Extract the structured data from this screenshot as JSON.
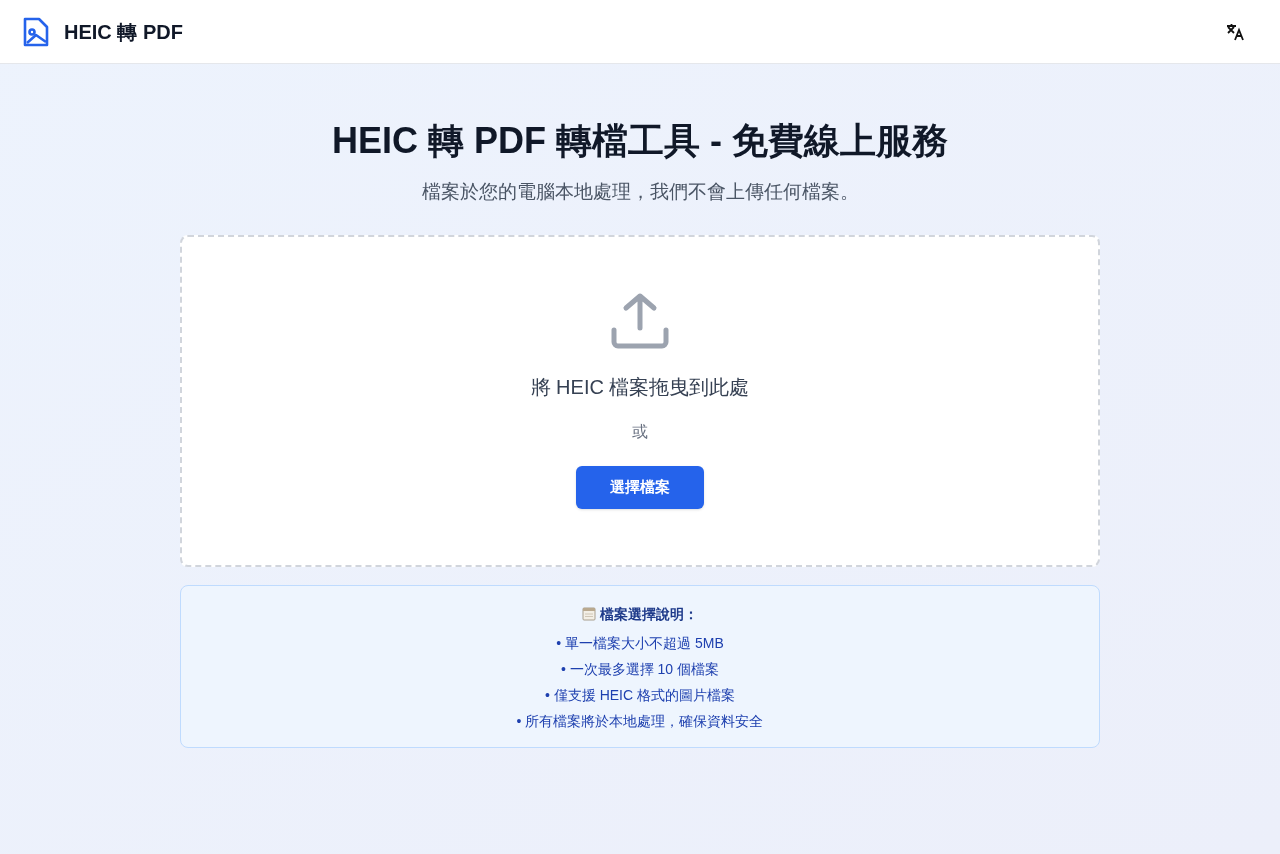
{
  "header": {
    "title": "HEIC 轉 PDF"
  },
  "hero": {
    "title": "HEIC 轉 PDF 轉檔工具 - 免費線上服務",
    "subtitle": "檔案於您的電腦本地處理，我們不會上傳任何檔案。"
  },
  "dropzone": {
    "prompt": "將 HEIC 檔案拖曳到此處",
    "separator": "或",
    "button": "選擇檔案"
  },
  "notes": {
    "title": "檔案選擇說明：",
    "items": [
      "• 單一檔案大小不超過 5MB",
      "• 一次最多選擇 10 個檔案",
      "• 僅支援 HEIC 格式的圖片檔案",
      "• 所有檔案將於本地處理，確保資料安全"
    ]
  }
}
